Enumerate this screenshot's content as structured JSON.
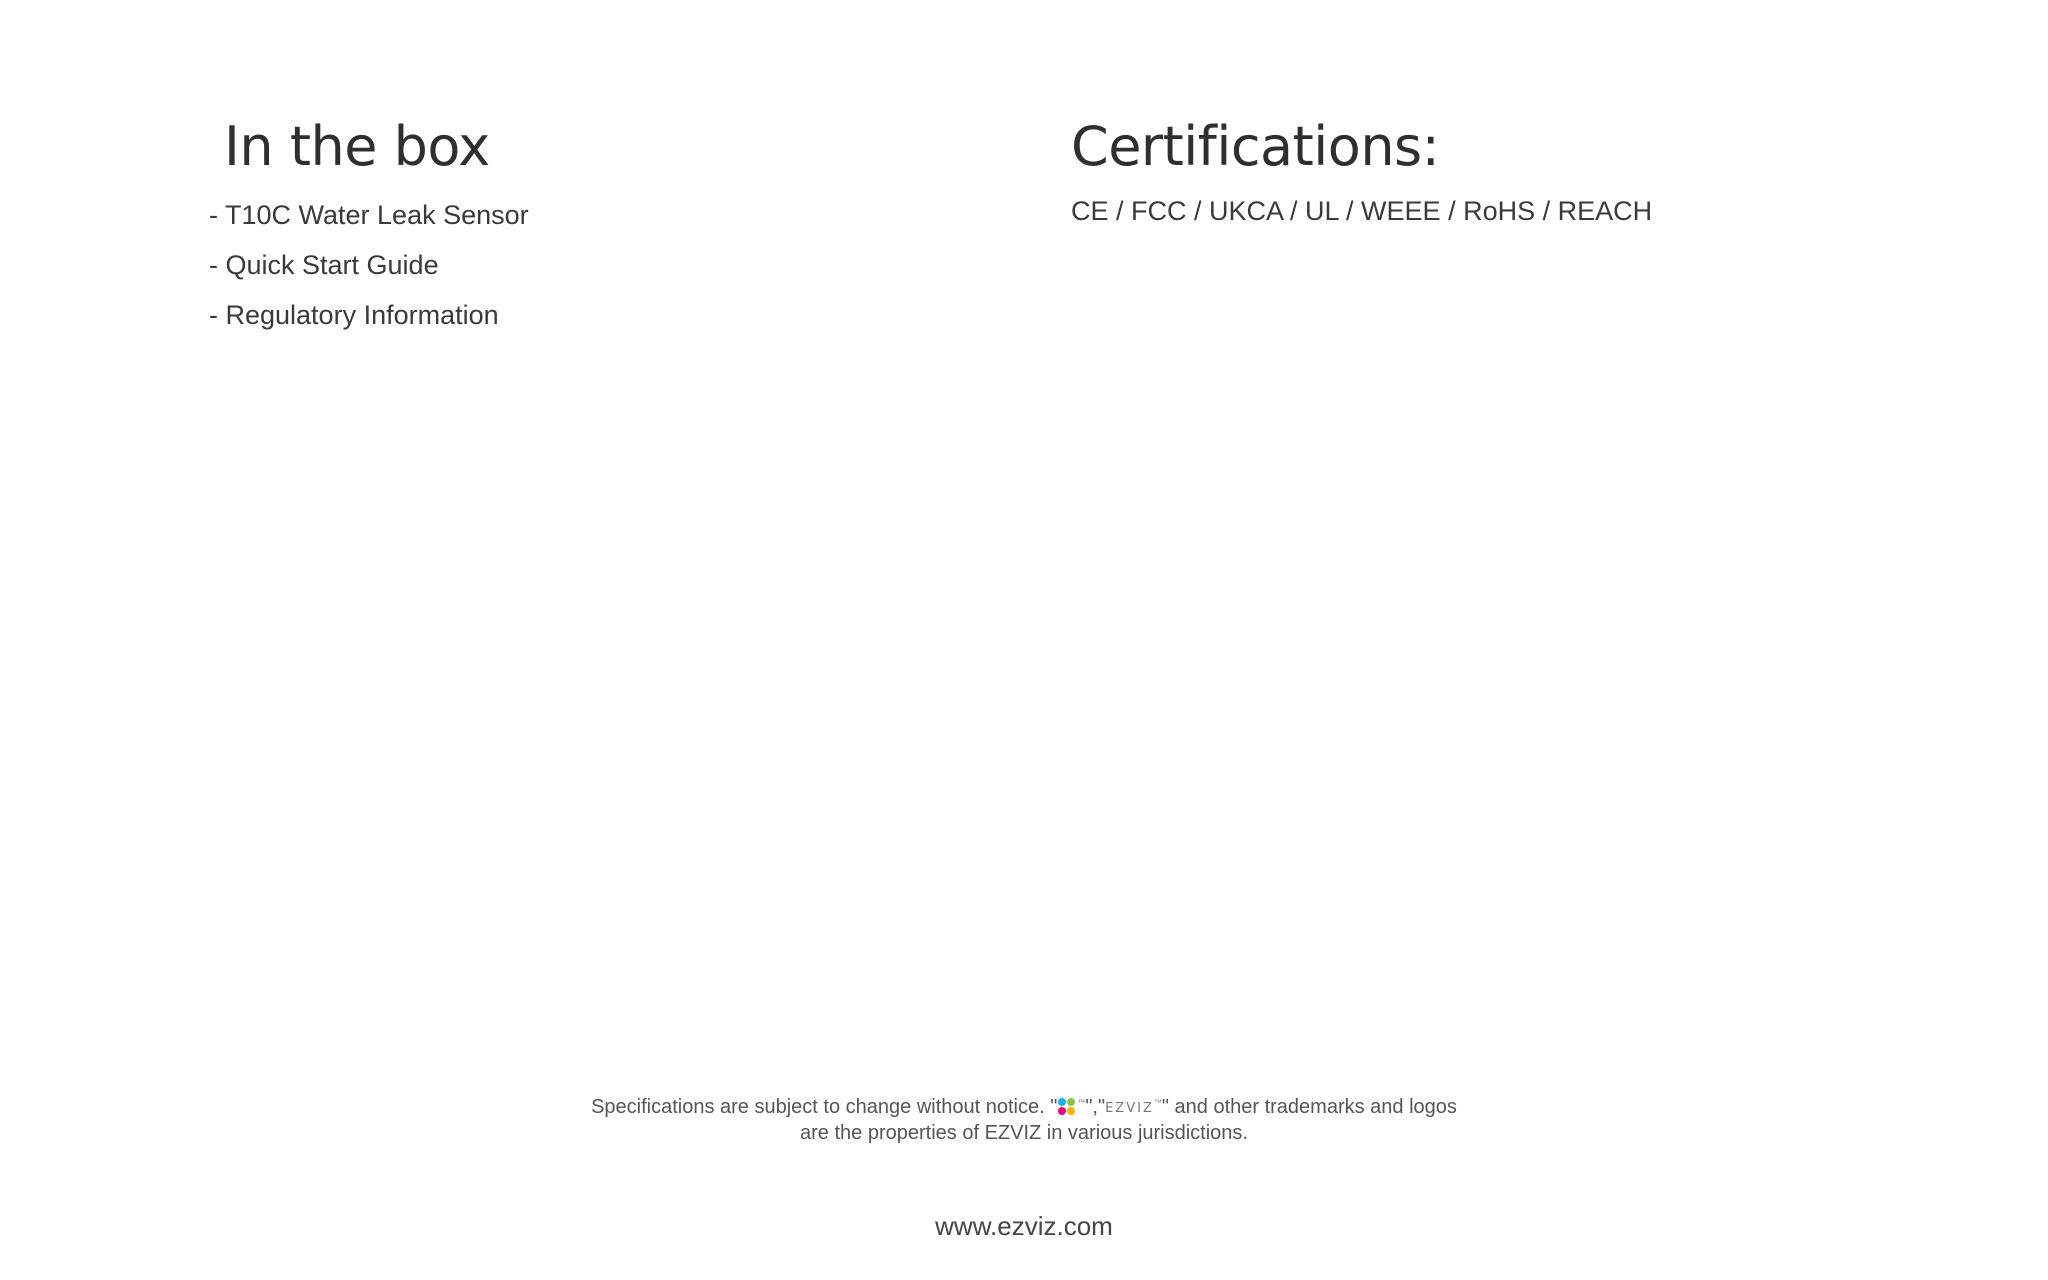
{
  "in_the_box": {
    "title": "In the box",
    "items": [
      "- T10C Water Leak Sensor",
      "- Quick Start Guide",
      "- Regulatory Information"
    ]
  },
  "certifications": {
    "title": "Certifications:",
    "list": "CE / FCC / UKCA / UL / WEEE / RoHS / REACH"
  },
  "footer": {
    "notice_prefix": "Specifications are subject to change without notice.  \"",
    "notice_sep": "\",\"",
    "logo_wordmark": "EZVIZ",
    "notice_suffix": "\" and other trademarks and logos",
    "notice_line2": "are the properties of EZVIZ in various jurisdictions.",
    "website": "www.ezviz.com"
  }
}
